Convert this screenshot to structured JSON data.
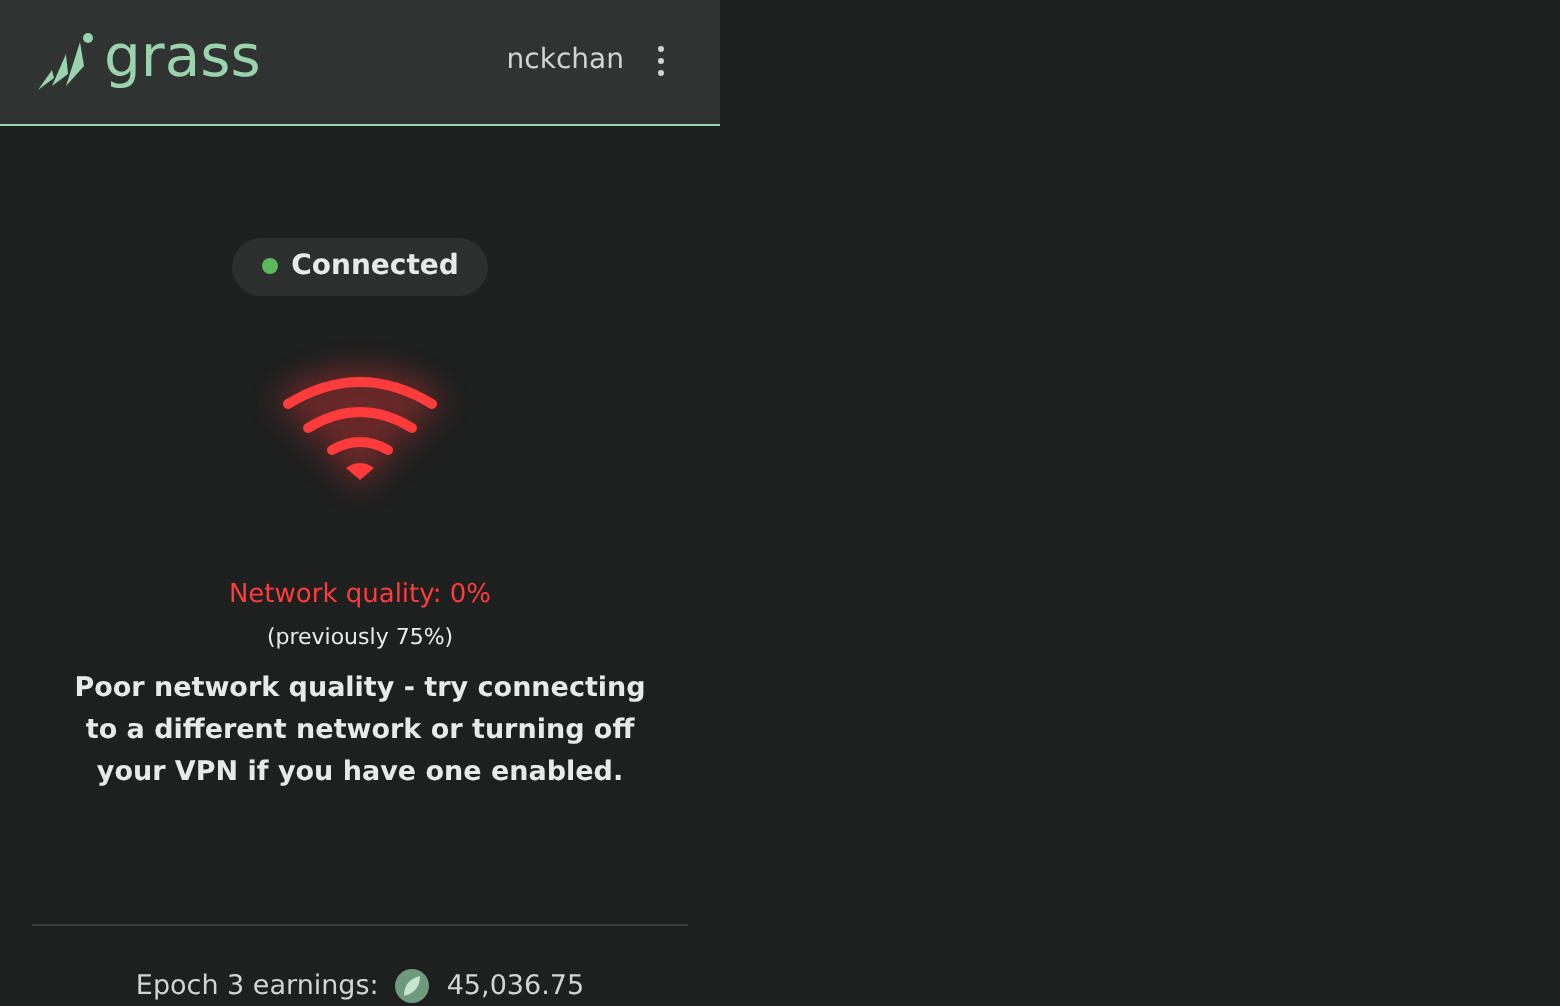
{
  "header": {
    "logo": "grass",
    "username": "nckchan"
  },
  "status": {
    "label": "Connected",
    "connected": true
  },
  "network": {
    "kind": "poor",
    "quality": "Network quality: 0%",
    "previous": "(previously 75%)",
    "message": "Poor network quality - try connecting to a different network or turning off your VPN if you have one enabled."
  },
  "earnings": {
    "label": "Epoch 3 earnings:",
    "value": "45,036.75"
  }
}
